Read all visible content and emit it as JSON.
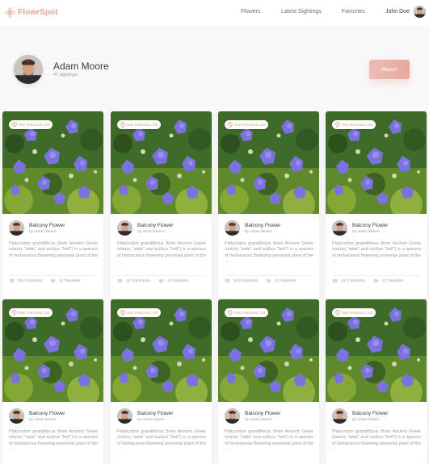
{
  "header": {
    "brand": "FlowrSpot",
    "nav": [
      "Flowers",
      "Latest Sightings",
      "Favorites"
    ],
    "user_name": "John Doe",
    "accent": "#e6a49b"
  },
  "profile": {
    "name": "Adam Moore",
    "sightings": "47 sightings",
    "report_label": "Report"
  },
  "cards": [
    {
      "location": "San Francisco, US",
      "title": "Balcony Flower",
      "author": "by Adam Moore",
      "description": "Platycodon grandiflorus (from Ancient Greek πλατύς \"wide\" and κώδων \"bell\") is a species of herbaceous flowering perennial plant of the ...",
      "comments": "18 Comments",
      "favorites": "12 Favorites"
    },
    {
      "location": "San Francisco, US",
      "title": "Balcony Flower",
      "author": "by Adam Moore",
      "description": "Platycodon grandiflorus (from Ancient Greek πλατύς \"wide\" and κώδων \"bell\") is a species of herbaceous flowering perennial plant of the ...",
      "comments": "18 Comments",
      "favorites": "12 Favorites"
    },
    {
      "location": "San Francisco, US",
      "title": "Balcony Flower",
      "author": "by Adam Moore",
      "description": "Platycodon grandiflorus (from Ancient Greek πλατύς \"wide\" and κώδων \"bell\") is a species of herbaceous flowering perennial plant of the ...",
      "comments": "18 Comments",
      "favorites": "12 Favorites"
    },
    {
      "location": "San Francisco, US",
      "title": "Balcony Flower",
      "author": "by Adam Moore",
      "description": "Platycodon grandiflorus (from Ancient Greek πλατύς \"wide\" and κώδων \"bell\") is a species of herbaceous flowering perennial plant of the ...",
      "comments": "18 Comments",
      "favorites": "12 Favorites"
    },
    {
      "location": "San Francisco, US",
      "title": "Balcony Flower",
      "author": "by Adam Moore",
      "description": "Platycodon grandiflorus (from Ancient Greek πλατύς \"wide\" and κώδων \"bell\") is a species of herbaceous flowering perennial plant of the ...",
      "comments": "18 Comments",
      "favorites": "12 Favorites"
    },
    {
      "location": "San Francisco, US",
      "title": "Balcony Flower",
      "author": "by Adam Moore",
      "description": "Platycodon grandiflorus (from Ancient Greek πλατύς \"wide\" and κώδων \"bell\") is a species of herbaceous flowering perennial plant of the ...",
      "comments": "18 Comments",
      "favorites": "12 Favorites"
    },
    {
      "location": "San Francisco, US",
      "title": "Balcony Flower",
      "author": "by Adam Moore",
      "description": "Platycodon grandiflorus (from Ancient Greek πλατύς \"wide\" and κώδων \"bell\") is a species of herbaceous flowering perennial plant of the ...",
      "comments": "18 Comments",
      "favorites": "12 Favorites"
    },
    {
      "location": "San Francisco, US",
      "title": "Balcony Flower",
      "author": "by Adam Moore",
      "description": "Platycodon grandiflorus (from Ancient Greek πλατύς \"wide\" and κώδων \"bell\") is a species of herbaceous flowering perennial plant of the ...",
      "comments": "18 Comments",
      "favorites": "12 Favorites"
    }
  ],
  "icons": {
    "logo": "flower-icon",
    "pin": "map-pin-icon",
    "comment": "comment-icon",
    "favorite": "heart-icon"
  }
}
